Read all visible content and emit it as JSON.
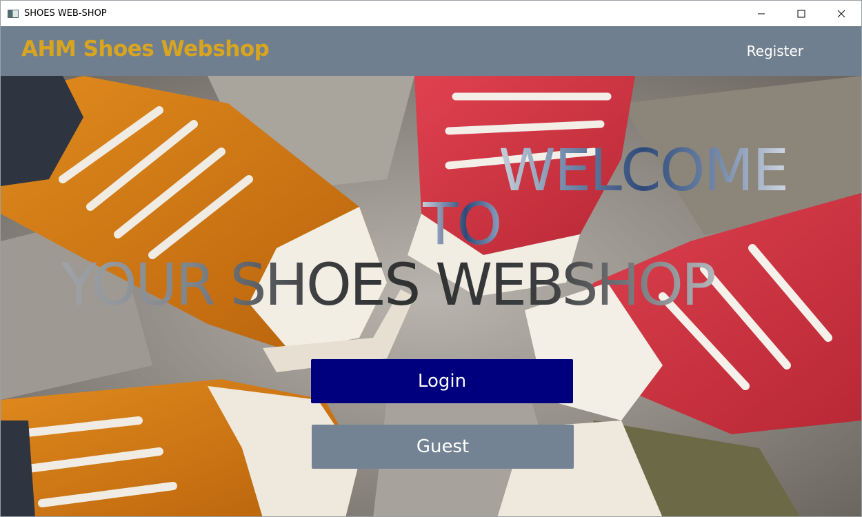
{
  "window": {
    "title": "SHOES WEB-SHOP",
    "controls": [
      "minimize-icon",
      "maximize-icon",
      "close-icon"
    ]
  },
  "header": {
    "brand": "AHM Shoes Webshop",
    "register_label": "Register",
    "brand_color": "#d9a520",
    "bar_color": "#6f7f8f"
  },
  "hero": {
    "welcome_line1": "WELCOME",
    "welcome_line2": "TO",
    "welcome_line3": "YOUR SHOES WEBSHOP",
    "background_image": "sneakers-photo"
  },
  "actions": {
    "login_label": "Login",
    "guest_label": "Guest",
    "login_color": "#00007f",
    "guest_color": "#748394"
  }
}
